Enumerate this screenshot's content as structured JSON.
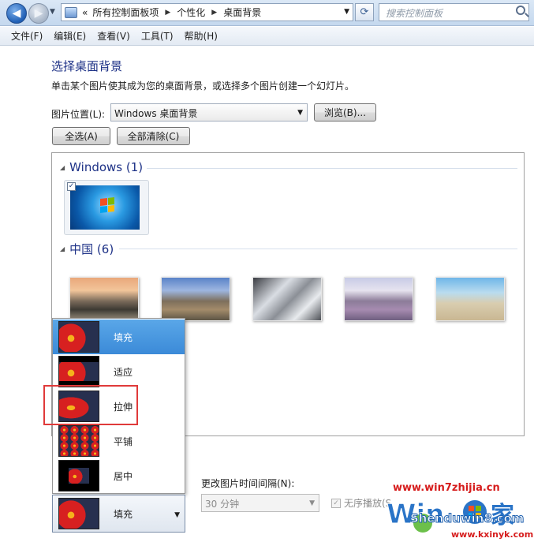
{
  "address_bar": {
    "prefix": "«",
    "breadcrumbs": [
      "所有控制面板项",
      "个性化",
      "桌面背景"
    ],
    "search_placeholder": "搜索控制面板"
  },
  "menu": [
    "文件(F)",
    "编辑(E)",
    "查看(V)",
    "工具(T)",
    "帮助(H)"
  ],
  "page": {
    "title": "选择桌面背景",
    "subtitle": "单击某个图片使其成为您的桌面背景，或选择多个图片创建一个幻灯片。",
    "location_label": "图片位置(L):",
    "location_value": "Windows 桌面背景",
    "browse_label": "浏览(B)...",
    "select_all_label": "全选(A)",
    "clear_all_label": "全部清除(C)"
  },
  "gallery": {
    "groups": [
      {
        "title": "Windows (1)",
        "checked": true
      },
      {
        "title": "中国 (6)"
      }
    ]
  },
  "position_popup": {
    "options": [
      "填充",
      "适应",
      "拉伸",
      "平铺",
      "居中"
    ],
    "selected_index": 0,
    "highlighted_index": 2
  },
  "position_select": {
    "value": "填充"
  },
  "interval": {
    "label": "更改图片时间间隔(N):",
    "value": "30 分钟",
    "shuffle_label": "无序播放(S"
  },
  "watermark": {
    "url1": "www.win7zhijia.cn",
    "text2": "Shenduwin8.com",
    "url2": "www.kxinyk.com"
  },
  "colors": {
    "title": "#1e3287",
    "selection": "#3b8ad8",
    "highlight_box": "#e03a3a"
  }
}
